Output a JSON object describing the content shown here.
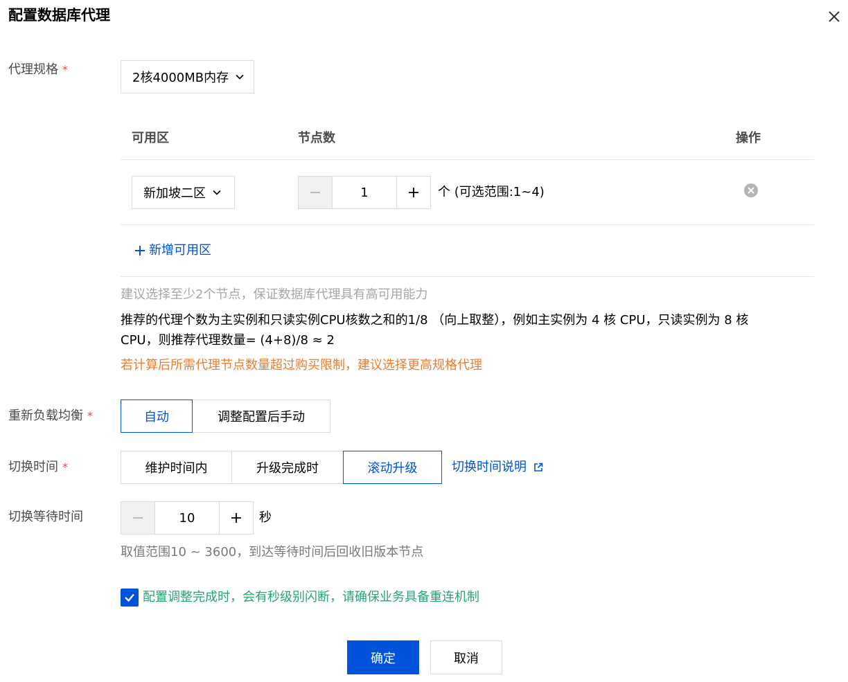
{
  "dialog": {
    "title": "配置数据库代理",
    "close_icon": "close-icon"
  },
  "spec": {
    "label": "代理规格",
    "required_mark": "*",
    "value": "2核4000MB内存"
  },
  "zone_table": {
    "headers": {
      "zone": "可用区",
      "nodes": "节点数",
      "action": "操作"
    },
    "rows": [
      {
        "zone": "新加坡二区",
        "node_count": "1",
        "unit_range": "个 (可选范围:1~4)"
      }
    ],
    "add_zone": "新增可用区"
  },
  "notes": {
    "hint": "建议选择至少2个节点，保证数据库代理具有高可用能力",
    "recommend_line1": "推荐的代理个数为主实例和只读实例CPU核数之和的1/8 （向上取整），例如主实例为 4 核 CPU，只读实例为 8 核",
    "recommend_line2": "CPU，则推荐代理数量= (4+8)/8 ≈ 2",
    "warning": "若计算后所需代理节点数量超过购买限制，建议选择更高规格代理"
  },
  "rebalance": {
    "label": "重新负载均衡",
    "required_mark": "*",
    "options": [
      "自动",
      "调整配置后手动"
    ],
    "selected": "自动"
  },
  "switch_time": {
    "label": "切换时间",
    "required_mark": "*",
    "options": [
      "维护时间内",
      "升级完成时",
      "滚动升级"
    ],
    "selected": "滚动升级",
    "help_link": "切换时间说明"
  },
  "wait_time": {
    "label": "切换等待时间",
    "value": "10",
    "unit": "秒",
    "hint": "取值范围10 ~ 3600，到达等待时间后回收旧版本节点"
  },
  "confirm_check": {
    "checked": true,
    "text": "配置调整完成时，会有秒级别闪断，请确保业务具备重连机制"
  },
  "footer": {
    "ok": "确定",
    "cancel": "取消"
  },
  "colors": {
    "primary": "#0052d9",
    "warning": "#ed7b2f",
    "success": "#2ba471",
    "required": "#e54545"
  }
}
